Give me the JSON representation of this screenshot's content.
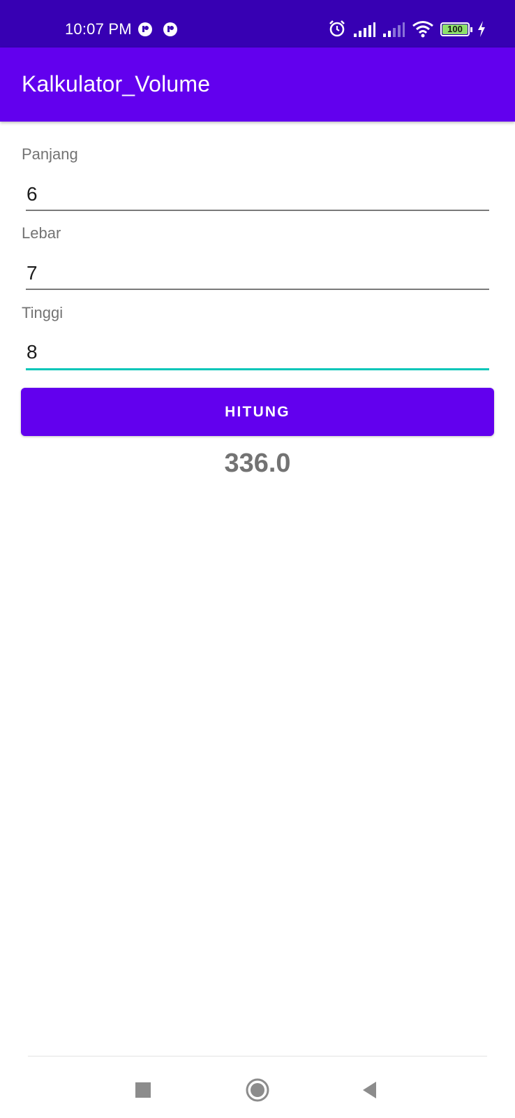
{
  "status_bar": {
    "time": "10:07 PM",
    "battery": "100",
    "background_color": "#3700b3",
    "icons": [
      "notification-app-icon",
      "notification-app-icon",
      "alarm-icon",
      "signal-icon",
      "signal-icon",
      "wifi-icon",
      "battery-icon",
      "charging-icon"
    ]
  },
  "app_bar": {
    "title": "Kalkulator_Volume",
    "background_color": "#6200ee"
  },
  "form": {
    "panjang": {
      "label": "Panjang",
      "value": "6"
    },
    "lebar": {
      "label": "Lebar",
      "value": "7"
    },
    "tinggi": {
      "label": "Tinggi",
      "value": "8"
    },
    "focus_color": "#03c6b8"
  },
  "button": {
    "label": "HITUNG",
    "color": "#6200ee"
  },
  "result": {
    "value": "336.0"
  },
  "nav_bar": {
    "icons": [
      "recents-square-icon",
      "home-circle-icon",
      "back-triangle-icon"
    ]
  }
}
